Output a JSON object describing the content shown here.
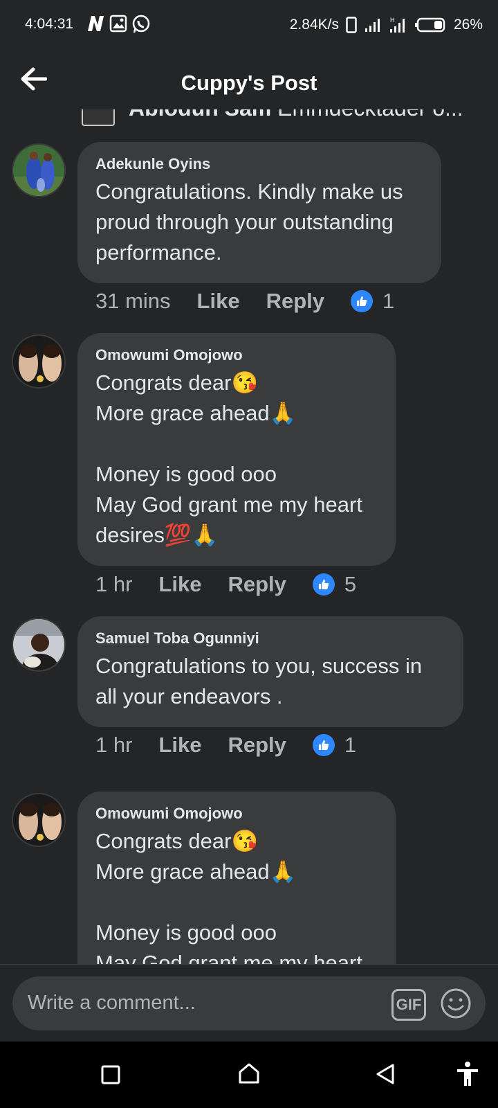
{
  "status_bar": {
    "time": "4:04:31",
    "net_speed": "2.84K/s",
    "battery": "26%",
    "icons": [
      "notification-n-icon",
      "gallery-icon",
      "whatsapp-icon",
      "phone-icon",
      "signal-icon",
      "signal-hd-icon",
      "battery-icon"
    ]
  },
  "header": {
    "title": "Cuppy's Post",
    "back_icon": "back-arrow-icon"
  },
  "previous_comment": {
    "author": "Abiodun Sam",
    "text": "Emmdecktader o..."
  },
  "comments": [
    {
      "author": "Adekunle Oyins",
      "text": "Congratulations. Kindly make us proud through your outstanding performance.",
      "time": "31 mins",
      "like_label": "Like",
      "reply_label": "Reply",
      "reaction_count": "1"
    },
    {
      "author": "Omowumi Omojowo",
      "text": "Congrats dear😘\nMore grace ahead🙏\n\nMoney is good ooo\nMay God grant me my heart desires💯🙏",
      "time": "1 hr",
      "like_label": "Like",
      "reply_label": "Reply",
      "reaction_count": "5"
    },
    {
      "author": "Samuel Toba Ogunniyi",
      "text": "Congratulations to you, success in all your endeavors .",
      "time": "1 hr",
      "like_label": "Like",
      "reply_label": "Reply",
      "reaction_count": "1"
    },
    {
      "author": "Omowumi Omojowo",
      "text": "Congrats dear😘\nMore grace ahead🙏\n\nMoney is good ooo\nMay God grant me my heart"
    }
  ],
  "composer": {
    "placeholder": "Write a comment...",
    "gif_label": "GIF"
  },
  "colors": {
    "background": "#242526",
    "bubble": "#3a3b3c",
    "accent_like": "#2d88ff",
    "secondary_text": "#b0b3b8"
  }
}
